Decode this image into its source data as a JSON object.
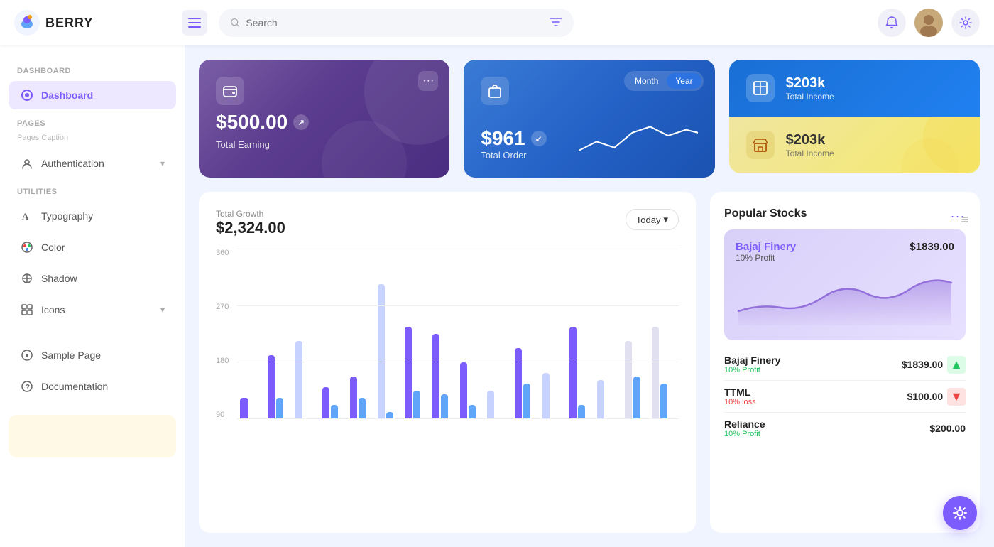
{
  "app": {
    "name": "BERRY",
    "logo_alt": "Berry logo"
  },
  "header": {
    "search_placeholder": "Search",
    "menu_label": "Menu",
    "filter_label": "Filter",
    "notifications_label": "Notifications",
    "settings_label": "Settings"
  },
  "sidebar": {
    "dashboard_section": "Dashboard",
    "dashboard_item": "Dashboard",
    "pages_section": "Pages",
    "pages_caption": "Pages Caption",
    "auth_item": "Authentication",
    "utilities_section": "Utilities",
    "typography_item": "Typography",
    "color_item": "Color",
    "shadow_item": "Shadow",
    "icons_item": "Icons",
    "sample_page_item": "Sample Page",
    "documentation_item": "Documentation"
  },
  "cards": {
    "earning": {
      "amount": "$500.00",
      "label": "Total Earning"
    },
    "order": {
      "amount": "$961",
      "label": "Total Order",
      "toggle": {
        "month": "Month",
        "year": "Year",
        "active": "Year"
      }
    },
    "income_top": {
      "amount": "$203k",
      "label": "Total Income"
    },
    "income_bottom": {
      "amount": "$203k",
      "label": "Total Income"
    }
  },
  "chart": {
    "title": "Total Growth",
    "amount": "$2,324.00",
    "period_btn": "Today",
    "y_labels": [
      "360",
      "270",
      "180",
      "90"
    ],
    "menu_icon": "≡"
  },
  "stocks": {
    "title": "Popular Stocks",
    "more_label": "...",
    "featured": {
      "name": "Bajaj Finery",
      "price": "$1839.00",
      "profit_label": "10% Profit"
    },
    "list": [
      {
        "name": "Bajaj Finery",
        "price": "$1839.00",
        "metric": "10% Profit",
        "trend": "up"
      },
      {
        "name": "TTML",
        "price": "$100.00",
        "metric": "10% loss",
        "trend": "down"
      },
      {
        "name": "Reliance",
        "price": "$200.00",
        "metric": "10% Profit",
        "trend": "up"
      }
    ]
  },
  "colors": {
    "primary": "#7c5cfc",
    "blue": "#2563eb",
    "success": "#22c55e",
    "danger": "#ef4444",
    "yellow": "#f5e96b"
  }
}
